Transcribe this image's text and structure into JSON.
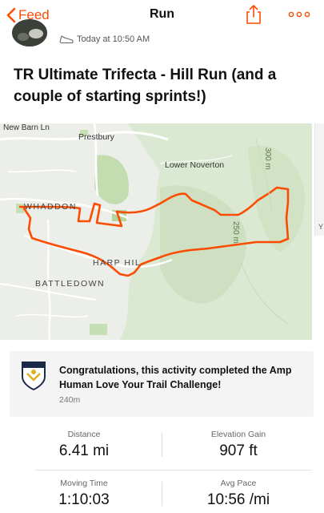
{
  "nav": {
    "back_label": "Feed",
    "title": "Run",
    "share_icon": "share-icon",
    "more_icon": "more-icon"
  },
  "activity": {
    "timestamp": "Today at 10:50 AM",
    "title": "TR Ultimate Trifecta - Hill Run (and a couple of starting sprints!)"
  },
  "map": {
    "labels": {
      "new_barn_ln": "New Barn Ln",
      "prestbury": "Prestbury",
      "lower_noverton": "Lower Noverton",
      "whaddon": "WHADDON",
      "harp_hill": "HARP HIL",
      "battledown": "BATTLEDOWN",
      "contour_300": "300 m",
      "contour_250": "250 m"
    },
    "route_color": "#fc4c02",
    "side_card_letter": "Y"
  },
  "achievement": {
    "text": "Congratulations, this activity completed the Amp Human Love Your Trail Challenge!",
    "distance": "240m",
    "badge_icon": "challenge-badge-icon"
  },
  "stats": [
    {
      "label": "Distance",
      "value": "6.41 mi"
    },
    {
      "label": "Elevation Gain",
      "value": "907 ft"
    },
    {
      "label": "Moving Time",
      "value": "1:10:03"
    },
    {
      "label": "Avg Pace",
      "value": "10:56 /mi"
    }
  ],
  "colors": {
    "accent": "#fc4c02",
    "map_green": "#cfe3c0",
    "map_dark_green": "#b9d6a6"
  }
}
